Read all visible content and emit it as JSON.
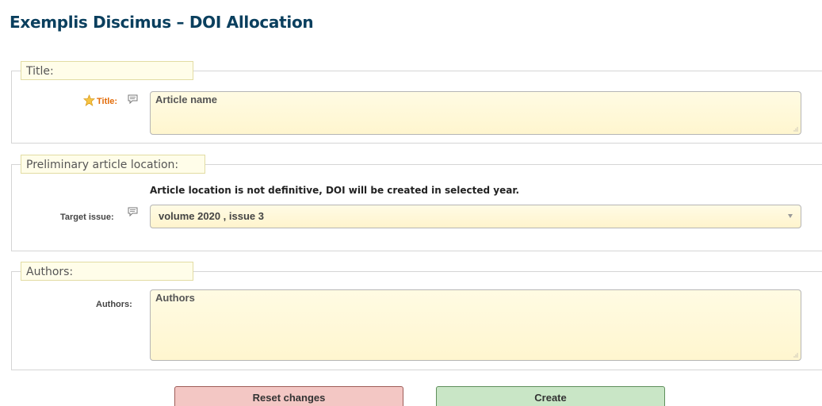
{
  "page": {
    "title": "Exemplis Discimus – DOI Allocation"
  },
  "sections": {
    "title_section": {
      "legend": "Title:",
      "field_label": "Title:",
      "field_value": "Article name"
    },
    "location_section": {
      "legend": "Preliminary article location:",
      "notice": "Article location is not definitive, DOI will be created in selected year.",
      "field_label": "Target issue:",
      "selected_option": "volume 2020 , issue 3"
    },
    "authors_section": {
      "legend": "Authors:",
      "field_label": "Authors:",
      "field_value": "Authors"
    }
  },
  "buttons": {
    "reset_label": "Reset changes",
    "create_label": "Create"
  },
  "colors": {
    "title": "#0a3f5e",
    "required_label": "#e36c09",
    "reset_button": "#f3c7c4",
    "create_button": "#c9e6c6",
    "field_background": "#fff8d9",
    "legend_background": "#fffde9"
  },
  "icons": {
    "required": "star-icon",
    "help": "comment-icon",
    "dropdown": "chevron-down-icon",
    "resize": "resize-grip-icon"
  }
}
